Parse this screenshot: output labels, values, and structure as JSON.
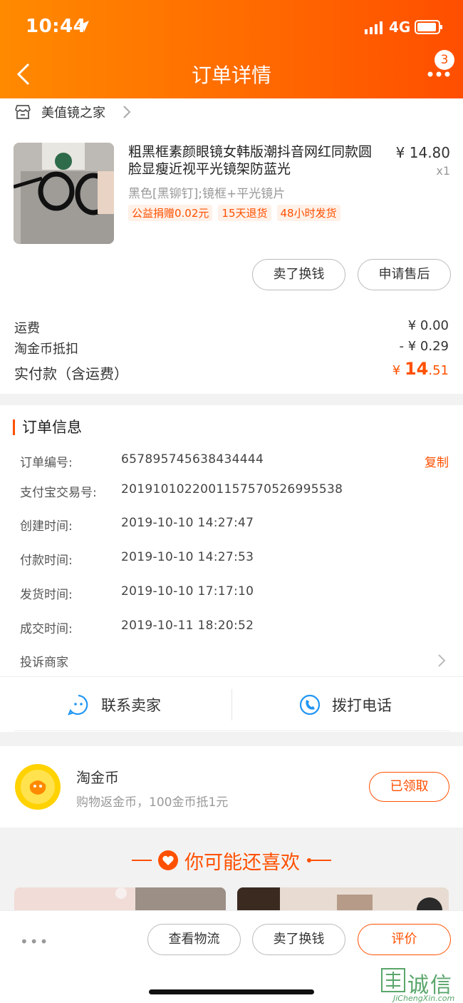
{
  "status_bar": {
    "time": "10:44",
    "network": "4G"
  },
  "nav": {
    "title": "订单详情",
    "badge_count": "3"
  },
  "shop": {
    "name": "美值镜之家"
  },
  "product": {
    "title": "粗黑框素颜眼镜女韩版潮抖音网红同款圆脸显瘦近视平光镜架防蓝光",
    "sku": "黑色[黑铆钉];镜框+平光镜片",
    "tags": [
      "公益捐赠0.02元",
      "15天退货",
      "48小时发货"
    ],
    "price": "¥ 14.80",
    "qty": "x1"
  },
  "item_actions": {
    "sell": "卖了换钱",
    "after_sale": "申请售后"
  },
  "fees": {
    "shipping_label": "运费",
    "shipping_value": "¥ 0.00",
    "coin_label": "淘金币抵扣",
    "coin_value": "- ¥ 0.29",
    "paid_label": "实付款（含运费）",
    "paid_symbol": "¥ ",
    "paid_int": "14",
    "paid_dec": ".51"
  },
  "order_info": {
    "title": "订单信息",
    "copy": "复制",
    "rows": [
      {
        "label": "订单编号:",
        "value": "657895745638434444"
      },
      {
        "label": "支付宝交易号:",
        "value": "2019101022001157570526995538"
      },
      {
        "label": "创建时间:",
        "value": "2019-10-10 14:27:47"
      },
      {
        "label": "付款时间:",
        "value": "2019-10-10 14:27:53"
      },
      {
        "label": "发货时间:",
        "value": "2019-10-10 17:17:10"
      },
      {
        "label": "成交时间:",
        "value": "2019-10-11 18:20:52"
      }
    ],
    "complain": "投诉商家"
  },
  "contact": {
    "seller": "联系卖家",
    "phone": "拨打电话"
  },
  "coins": {
    "title": "淘金币",
    "subtitle": "购物返金币，100金币抵1元",
    "button": "已领取"
  },
  "recommend": {
    "title": "你可能还喜欢"
  },
  "bottom_actions": {
    "logistics": "查看物流",
    "sell": "卖了换钱",
    "review": "评价",
    "more": "•••"
  },
  "watermark": {
    "cn": "诚信",
    "en": "JiChengXin.com"
  },
  "colors": {
    "accent": "#ff5000",
    "header_start": "#ff8a00",
    "header_end": "#ff4e00",
    "contact_blue": "#2196f3"
  }
}
